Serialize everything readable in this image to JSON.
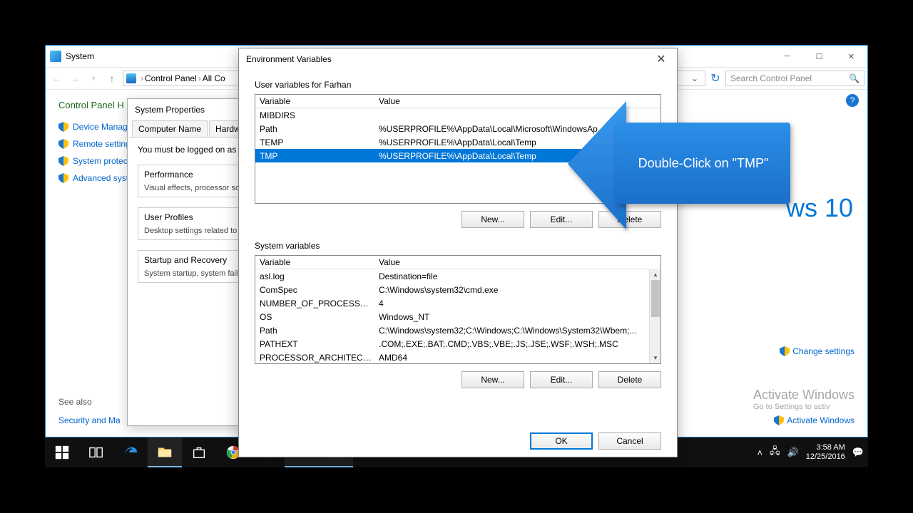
{
  "systemWindow": {
    "title": "System",
    "breadcrumb": {
      "part1": "Control Panel",
      "part2": "All Co"
    },
    "searchPlaceholder": "Search Control Panel",
    "cpHome": "Control Panel H",
    "links": {
      "deviceManager": "Device Manager",
      "remoteSettings": "Remote settings",
      "systemProtection": "System protectio",
      "advancedSystem": "Advanced syste"
    },
    "seeAlso": "See also",
    "secMaint": "Security and Ma",
    "win10Brand": "ws 10",
    "changeSettings": "Change settings",
    "activateTitle": "Activate Windows",
    "activateSub": "Go to Settings to activ",
    "activateLink": "Activate Windows"
  },
  "sysprop": {
    "title": "System Properties",
    "tabs": {
      "computerName": "Computer Name",
      "hardware": "Hardware"
    },
    "note": "You must be logged on as an",
    "perf": {
      "title": "Performance",
      "desc": "Visual effects, processor sc"
    },
    "profiles": {
      "title": "User Profiles",
      "desc": "Desktop settings related to"
    },
    "startup": {
      "title": "Startup and Recovery",
      "desc": "System startup, system failu"
    }
  },
  "env": {
    "title": "Environment Variables",
    "userLabel": "User variables for Farhan",
    "headerVar": "Variable",
    "headerVal": "Value",
    "userVars": [
      {
        "name": "MIBDIRS",
        "value": ""
      },
      {
        "name": "Path",
        "value": "%USERPROFILE%\\AppData\\Local\\Microsoft\\WindowsAp"
      },
      {
        "name": "TEMP",
        "value": "%USERPROFILE%\\AppData\\Local\\Temp"
      },
      {
        "name": "TMP",
        "value": "%USERPROFILE%\\AppData\\Local\\Temp",
        "selected": true
      }
    ],
    "sysLabel": "System variables",
    "sysVars": [
      {
        "name": "asl.log",
        "value": "Destination=file"
      },
      {
        "name": "ComSpec",
        "value": "C:\\Windows\\system32\\cmd.exe"
      },
      {
        "name": "NUMBER_OF_PROCESSORS",
        "value": "4"
      },
      {
        "name": "OS",
        "value": "Windows_NT"
      },
      {
        "name": "Path",
        "value": "C:\\Windows\\system32;C:\\Windows;C:\\Windows\\System32\\Wbem;..."
      },
      {
        "name": "PATHEXT",
        "value": ".COM;.EXE;.BAT;.CMD;.VBS;.VBE;.JS;.JSE;.WSF;.WSH;.MSC"
      },
      {
        "name": "PROCESSOR_ARCHITECTURE",
        "value": "AMD64"
      }
    ],
    "btnNew": "New...",
    "btnEdit": "Edit...",
    "btnDelete": "Delete",
    "btnOK": "OK",
    "btnCancel": "Cancel"
  },
  "annotation": "Double-Click on \"TMP\"",
  "tray": {
    "time": "3:58 AM",
    "date": "12/25/2016"
  }
}
